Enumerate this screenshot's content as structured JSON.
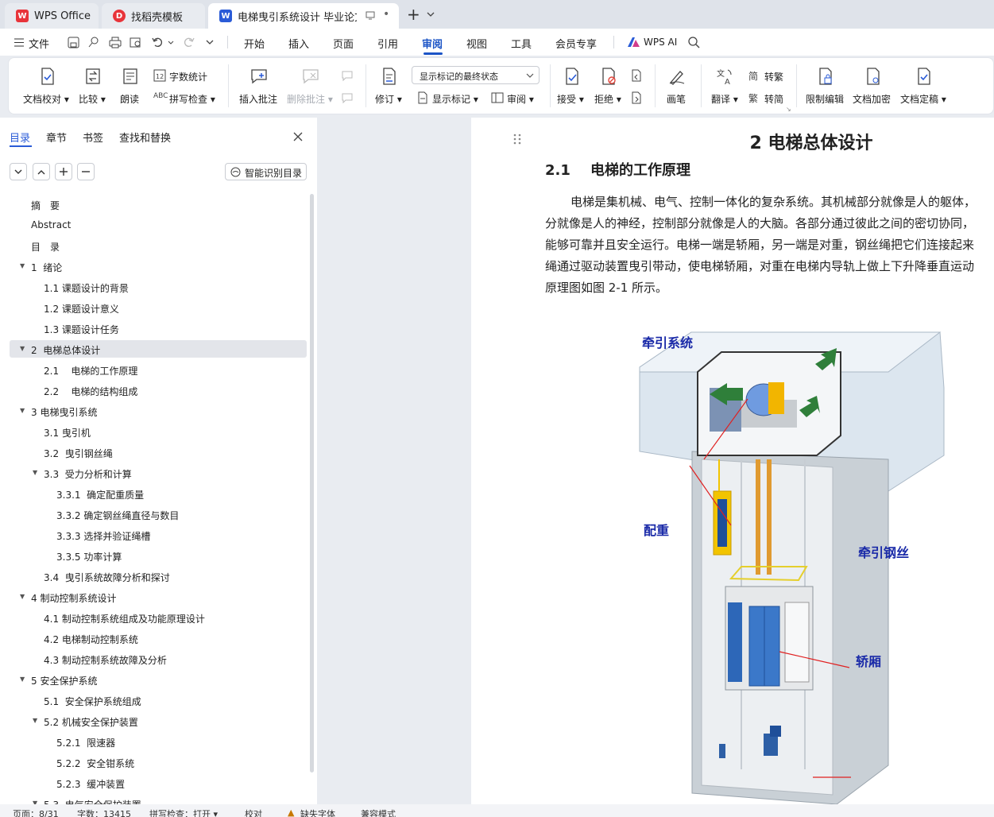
{
  "tabs": [
    {
      "label": "WPS Office"
    },
    {
      "label": "找稻壳模板"
    },
    {
      "label": "电梯曳引系统设计 毕业论文.d"
    }
  ],
  "menu": {
    "file": "文件",
    "items": [
      "开始",
      "插入",
      "页面",
      "引用",
      "审阅",
      "视图",
      "工具",
      "会员专享"
    ],
    "active": "审阅",
    "wps_ai": "WPS AI"
  },
  "ribbon": {
    "doc_check": "文档校对",
    "compare": "比较",
    "read_aloud": "朗读",
    "word_count": "字数统计",
    "spell_check": "拼写检查",
    "insert_comment": "插入批注",
    "delete_comment": "删除批注",
    "revise": "修订",
    "show_state": "显示标记的最终状态",
    "show_markup": "显示标记",
    "review": "审阅",
    "accept": "接受",
    "reject": "拒绝",
    "pen": "画笔",
    "translate": "翻译",
    "to_traditional": "转繁",
    "to_simplified": "转简",
    "restrict_edit": "限制编辑",
    "encrypt": "文档加密",
    "finalize": "文档定稿"
  },
  "left_panel": {
    "tabs": [
      "目录",
      "章节",
      "书签",
      "查找和替换"
    ],
    "active_tab": "目录",
    "smart_toc": "智能识别目录",
    "toc": [
      {
        "label": "摘　要",
        "level": 0,
        "arrow": "none"
      },
      {
        "label": "Abstract",
        "level": 0,
        "arrow": "none"
      },
      {
        "label": "目　录",
        "level": 0,
        "arrow": "none"
      },
      {
        "label": "1  绪论",
        "level": 0,
        "arrow": "down"
      },
      {
        "label": "1.1 课题设计的背景",
        "level": 1,
        "arrow": "none"
      },
      {
        "label": "1.2 课题设计意义",
        "level": 1,
        "arrow": "none"
      },
      {
        "label": "1.3 课题设计任务",
        "level": 1,
        "arrow": "none"
      },
      {
        "label": "2  电梯总体设计",
        "level": 0,
        "arrow": "down",
        "selected": true
      },
      {
        "label": "2.1    电梯的工作原理",
        "level": 1,
        "arrow": "none"
      },
      {
        "label": "2.2    电梯的结构组成",
        "level": 1,
        "arrow": "none"
      },
      {
        "label": "3 电梯曳引系统",
        "level": 0,
        "arrow": "down"
      },
      {
        "label": "3.1 曳引机",
        "level": 1,
        "arrow": "none"
      },
      {
        "label": "3.2  曳引钢丝绳",
        "level": 1,
        "arrow": "none"
      },
      {
        "label": "3.3  受力分析和计算",
        "level": 1,
        "arrow": "down"
      },
      {
        "label": "3.3.1  确定配重质量",
        "level": 2,
        "arrow": "none"
      },
      {
        "label": "3.3.2 确定钢丝绳直径与数目",
        "level": 2,
        "arrow": "none"
      },
      {
        "label": "3.3.3 选择并验证绳槽",
        "level": 2,
        "arrow": "none"
      },
      {
        "label": "3.3.5 功率计算",
        "level": 2,
        "arrow": "none"
      },
      {
        "label": "3.4  曳引系统故障分析和探讨",
        "level": 1,
        "arrow": "none"
      },
      {
        "label": "4 制动控制系统设计",
        "level": 0,
        "arrow": "down"
      },
      {
        "label": "4.1 制动控制系统组成及功能原理设计",
        "level": 1,
        "arrow": "none"
      },
      {
        "label": "4.2 电梯制动控制系统",
        "level": 1,
        "arrow": "none"
      },
      {
        "label": "4.3 制动控制系统故障及分析",
        "level": 1,
        "arrow": "none"
      },
      {
        "label": "5 安全保护系统",
        "level": 0,
        "arrow": "down"
      },
      {
        "label": "5.1  安全保护系统组成",
        "level": 1,
        "arrow": "none"
      },
      {
        "label": "5.2 机械安全保护装置",
        "level": 1,
        "arrow": "down"
      },
      {
        "label": "5.2.1  限速器",
        "level": 2,
        "arrow": "none"
      },
      {
        "label": "5.2.2  安全钳系统",
        "level": 2,
        "arrow": "none"
      },
      {
        "label": "5.2.3  缓冲装置",
        "level": 2,
        "arrow": "none"
      },
      {
        "label": "5.3  电气安全保护装置",
        "level": 1,
        "arrow": "down"
      }
    ]
  },
  "document": {
    "chapter_title": "2  电梯总体设计",
    "section_title": "2.1    电梯的工作原理",
    "paragraph_lines": [
      "电梯是集机械、电气、控制一体化的复杂系统。其机械部分就像是人的躯体，",
      "分就像是人的神经，控制部分就像是人的大脑。各部分通过彼此之间的密切协同，",
      "能够可靠并且安全运行。电梯一端是轿厢，另一端是对重，钢丝绳把它们连接起来",
      "绳通过驱动装置曳引带动，使电梯轿厢，对重在电梯内导轨上做上下升降垂直运动",
      "原理图如图 2-1 所示。"
    ],
    "figure_labels": {
      "traction_system": "牵引系统",
      "counterweight": "配重",
      "traction_rope": "牵引钢丝",
      "car": "轿厢"
    }
  },
  "status": {
    "page": "页面：8/31",
    "words": "字数：13415",
    "spell": "拼写检查：打开",
    "proof": "校对",
    "missing_font": "缺失字体",
    "compat": "兼容模式"
  },
  "colors": {
    "accent": "#2a5bd7",
    "active_menu": "#1b54c6",
    "selected_row": "#e3e5ea",
    "figure_label": "#1a2aa8"
  }
}
